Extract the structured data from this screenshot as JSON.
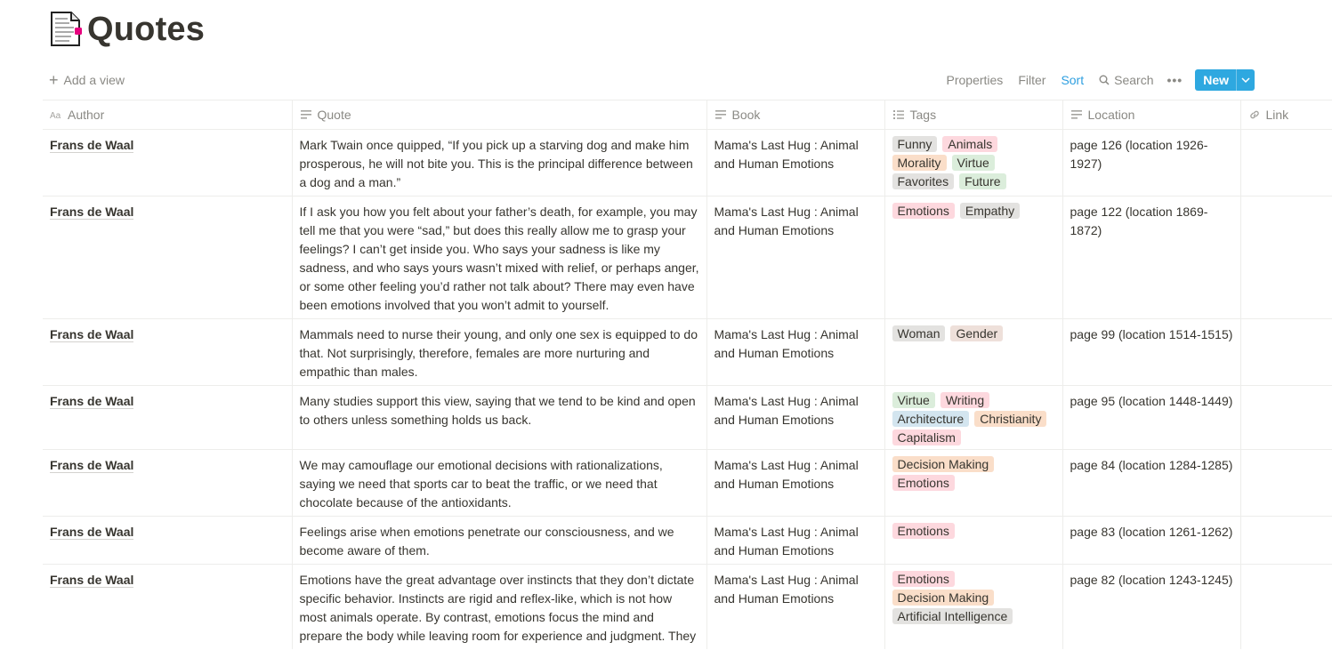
{
  "page": {
    "title": "Quotes"
  },
  "toolbar": {
    "add_view": "Add a view",
    "properties": "Properties",
    "filter": "Filter",
    "sort": "Sort",
    "search": "Search",
    "more": "•••",
    "new": "New"
  },
  "columns": {
    "author": "Author",
    "quote": "Quote",
    "book": "Book",
    "tags": "Tags",
    "location": "Location",
    "link": "Link"
  },
  "tag_colors": {
    "gray": "#e3e2e0",
    "brown": "#eee0da",
    "orange": "#fadec9",
    "green": "#dbeddb",
    "blue": "#d3e5ef",
    "red": "#ffe2dd",
    "pink": "#f5e0e9"
  },
  "rows": [
    {
      "author": "Frans de Waal",
      "quote": "Mark Twain once quipped, “If you pick up a starving dog and make him prosperous, he will not bite you. This is the principal difference between a dog and a man.”",
      "book": "Mama's Last Hug : Animal and Human Emotions",
      "tags": [
        {
          "label": "Funny",
          "color": "#e3e2e0"
        },
        {
          "label": "Animals",
          "color": "#fdd8de"
        },
        {
          "label": "Morality",
          "color": "#fadec9"
        },
        {
          "label": "Virtue",
          "color": "#dbeddb"
        },
        {
          "label": "Favorites",
          "color": "#e3e2e0"
        },
        {
          "label": "Future",
          "color": "#dbeddb"
        }
      ],
      "location": "page 126 (location 1926-1927)"
    },
    {
      "author": "Frans de Waal",
      "quote": "If I ask you how you felt about your father’s death, for example, you may tell me that you were “sad,” but does this really allow me to grasp your feelings? I can’t get inside you. Who says your sadness is like my sadness, and who says yours wasn’t mixed with relief, or perhaps anger, or some other feeling you’d rather not talk about? There may even have been emotions involved that you won’t admit to yourself.",
      "book": "Mama's Last Hug : Animal and Human Emotions",
      "tags": [
        {
          "label": "Emotions",
          "color": "#fdd8de"
        },
        {
          "label": "Empathy",
          "color": "#e3e2e0"
        }
      ],
      "location": "page 122 (location 1869-1872)"
    },
    {
      "author": "Frans de Waal",
      "quote": "Mammals need to nurse their young, and only one sex is equipped to do that. Not surprisingly, therefore, females are more nurturing and empathic than males.",
      "book": "Mama's Last Hug : Animal and Human Emotions",
      "tags": [
        {
          "label": "Woman",
          "color": "#e3e2e0"
        },
        {
          "label": "Gender",
          "color": "#eee0da"
        }
      ],
      "location": "page 99 (location 1514-1515)"
    },
    {
      "author": "Frans de Waal",
      "quote": "Many studies support this view, saying that we tend to be kind and open to others unless something holds us back.",
      "book": "Mama's Last Hug : Animal and Human Emotions",
      "tags": [
        {
          "label": "Virtue",
          "color": "#dbeddb"
        },
        {
          "label": "Writing",
          "color": "#fdd8de"
        },
        {
          "label": "Architecture",
          "color": "#d3e5ef"
        },
        {
          "label": "Christianity",
          "color": "#fadec9"
        },
        {
          "label": "Capitalism",
          "color": "#fdd8de"
        }
      ],
      "location": "page 95 (location 1448-1449)"
    },
    {
      "author": "Frans de Waal",
      "quote": "We may camouflage our emotional decisions with rationalizations, saying we need that sports car to beat the traffic, or we need that chocolate because of the antioxidants.",
      "book": "Mama's Last Hug : Animal and Human Emotions",
      "tags": [
        {
          "label": "Decision Making",
          "color": "#fadec9"
        },
        {
          "label": "Emotions",
          "color": "#fdd8de"
        }
      ],
      "location": "page 84 (location 1284-1285)"
    },
    {
      "author": "Frans de Waal",
      "quote": "Feelings arise when emotions penetrate our consciousness, and we become aware of them.",
      "book": "Mama's Last Hug : Animal and Human Emotions",
      "tags": [
        {
          "label": "Emotions",
          "color": "#fdd8de"
        }
      ],
      "location": "page 83 (location 1261-1262)"
    },
    {
      "author": "Frans de Waal",
      "quote": "Emotions have the great advantage over instincts that they don’t dictate specific behavior. Instincts are rigid and reflex-like, which is not how most animals operate. By contrast, emotions focus the mind and prepare the body while leaving room for experience and judgment. They",
      "book": "Mama's Last Hug : Animal and Human Emotions",
      "tags": [
        {
          "label": "Emotions",
          "color": "#fdd8de"
        },
        {
          "label": "Decision Making",
          "color": "#fadec9"
        },
        {
          "label": "Artificial Intelligence",
          "color": "#e3e2e0"
        }
      ],
      "location": "page 82 (location 1243-1245)"
    }
  ]
}
